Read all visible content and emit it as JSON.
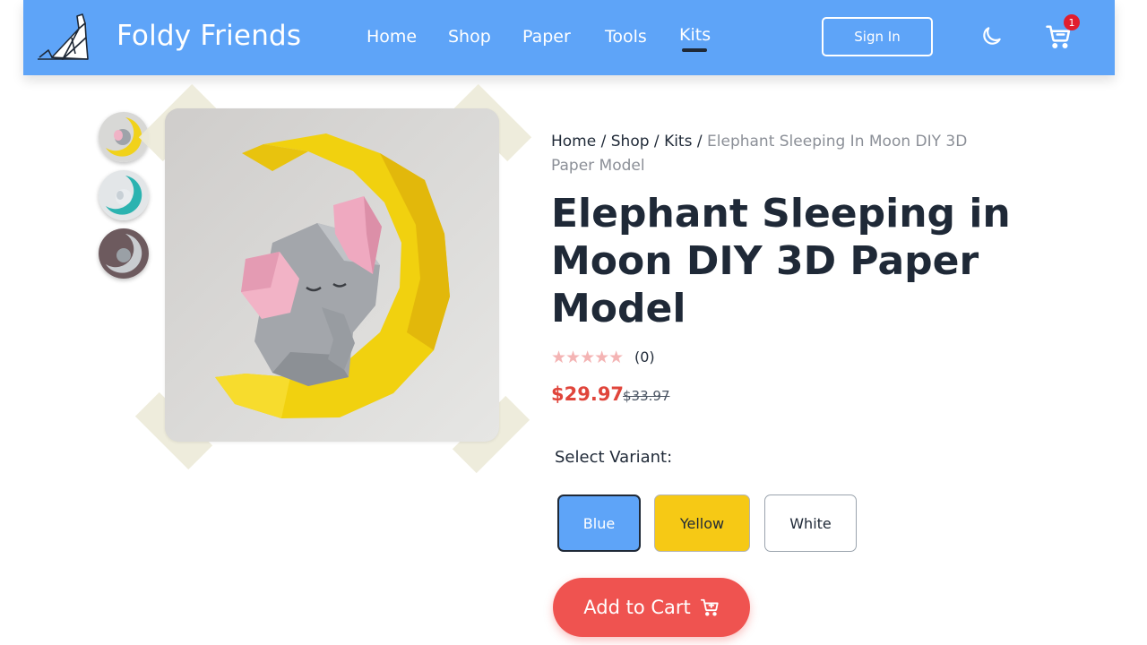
{
  "navbar": {
    "brand": "Foldy Friends",
    "links": [
      "Home",
      "Shop",
      "Paper",
      "Tools",
      "Kits"
    ],
    "active_link": "Kits",
    "signin_label": "Sign In",
    "cart_count": "1",
    "colors": {
      "bar": "#5ea4f8",
      "badge": "#e11d2e"
    }
  },
  "gallery": {
    "thumbnails": [
      "elephant-moon-yellow",
      "elephant-moon-teal",
      "elephant-moon-silver"
    ],
    "main_image": "elephant-sleeping-in-yellow-moon"
  },
  "breadcrumb": {
    "items": [
      "Home",
      "Shop",
      "Kits"
    ],
    "separator": "/",
    "current": "Elephant Sleeping In Moon DIY 3D Paper Model"
  },
  "product": {
    "title": "Elephant Sleeping in Moon DIY 3D Paper Model",
    "rating_stars": "★★★★★",
    "rating": 0,
    "review_count": "(0)",
    "price": "$29.97",
    "old_price": "$33.97"
  },
  "variants": {
    "label": "Select Variant:",
    "options": [
      "Blue",
      "Yellow",
      "White"
    ],
    "selected": "Blue",
    "colors": {
      "blue": "#5ea4f8",
      "yellow": "#f6c915",
      "white": "#ffffff"
    }
  },
  "actions": {
    "add_to_cart": "Add to Cart",
    "color": "#ef5350"
  }
}
